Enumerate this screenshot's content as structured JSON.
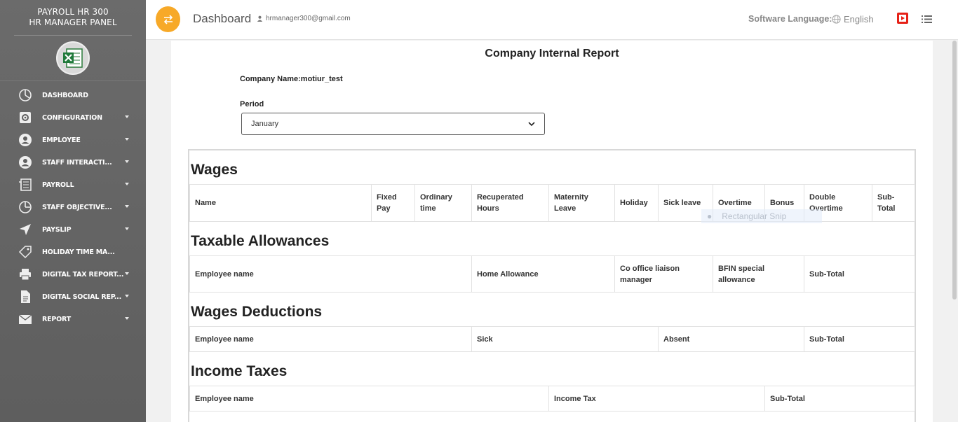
{
  "sidebar": {
    "brand_line1": "PAYROLL HR 300",
    "brand_line2": "HR MANAGER PANEL",
    "items": [
      {
        "label": "DASHBOARD",
        "icon": "dashboard-pie-icon"
      },
      {
        "label": "CONFIGURATION",
        "icon": "gear-icon"
      },
      {
        "label": "EMPLOYEE",
        "icon": "user-circle-icon"
      },
      {
        "label": "STAFF INTERACTI...",
        "icon": "user-circle-icon"
      },
      {
        "label": "PAYROLL",
        "icon": "newspaper-icon"
      },
      {
        "label": "STAFF OBJECTIVE...",
        "icon": "pie-chart-icon"
      },
      {
        "label": "PAYSLIP",
        "icon": "paper-plane-icon"
      },
      {
        "label": "HOLIDAY TIME MA...",
        "icon": "tag-icon"
      },
      {
        "label": "DIGITAL TAX REPORT...",
        "icon": "printer-icon"
      },
      {
        "label": "DIGITAL SOCIAL REP...",
        "icon": "document-icon"
      },
      {
        "label": "REPORT",
        "icon": "envelope-icon"
      }
    ]
  },
  "header": {
    "title": "Dashboard",
    "user_email": "hrmanager300@gmail.com",
    "language_label": "Software Language:",
    "language_value": "English"
  },
  "report": {
    "title": "Company Internal Report",
    "company_name": "Company Name:motiur_test",
    "period_label": "Period",
    "period_value": "January"
  },
  "wages": {
    "title": "Wages",
    "columns": [
      "Name",
      "Fixed Pay",
      "Ordinary time",
      "Recuperated Hours",
      "Maternity Leave",
      "Holiday",
      "Sick leave",
      "Overtime",
      "Bonus",
      "Double Overtime",
      "Sub-Total"
    ]
  },
  "taxable": {
    "title": "Taxable Allowances",
    "columns": [
      "Employee name",
      "Home Allowance",
      "Co office liaison manager",
      "BFIN special allowance",
      "Sub-Total"
    ]
  },
  "deductions": {
    "title": "Wages Deductions",
    "columns": [
      "Employee name",
      "Sick",
      "Absent",
      "Sub-Total"
    ]
  },
  "income": {
    "title": "Income Taxes",
    "columns": [
      "Employee name",
      "Income Tax",
      "Sub-Total"
    ]
  },
  "overlay": {
    "snip_label": "Rectangular Snip"
  },
  "colors": {
    "sidebar": "#636363",
    "accent": "#f7a928",
    "youtube": "#e62117"
  }
}
